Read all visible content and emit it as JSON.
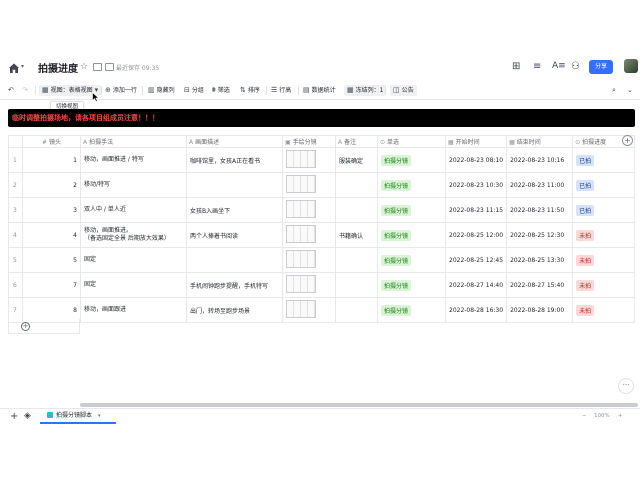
{
  "header": {
    "title": "拍摄进度",
    "save_status": "最近保存 09:35",
    "share_label": "分享"
  },
  "toolbar": {
    "view_label": "视图：表格视图",
    "tooltip": "切换视图",
    "add_row": "添加一行",
    "hide_columns": "隐藏列",
    "group": "分组",
    "filter": "筛选",
    "sort": "排序",
    "row_height": "行高",
    "stats": "数据统计",
    "freeze": "冻结列：1",
    "notice": "公告"
  },
  "banner": {
    "text": "临时调整拍摄场地，请各项目组成员注意！！！",
    "color": "#f54a45"
  },
  "columns": [
    "镜头",
    "拍摄手法",
    "画面描述",
    "手绘分镜",
    "备注",
    "单选",
    "开始时间",
    "结束时间",
    "拍摄进度"
  ],
  "rows": [
    {
      "idx": "1",
      "shot": "1",
      "method": "移动，画面推进 / 特写",
      "desc": "咖啡馆里，女孩A正在看书",
      "note": "服装确定",
      "single": "拍摄分镜",
      "start": "2022-08-23 08:10",
      "end": "2022-08-23 10:16",
      "progress": "已拍"
    },
    {
      "idx": "2",
      "shot": "2",
      "method": "移动/特写",
      "desc": "",
      "note": "",
      "single": "拍摄分镜",
      "start": "2022-08-23 10:30",
      "end": "2022-08-23 11:00",
      "progress": "已拍"
    },
    {
      "idx": "3",
      "shot": "3",
      "method": "双人中 / 单人近",
      "desc": "女孩B入画坐下",
      "note": "",
      "single": "拍摄分镜",
      "start": "2022-08-23 11:15",
      "end": "2022-08-23 11:50",
      "progress": "已拍"
    },
    {
      "idx": "4",
      "shot": "4",
      "method": "移动，画面推进。\n（备选固定全景 后期放大效果）",
      "desc": "两个人捧着书阅读",
      "note": "书籍确认",
      "single": "拍摄分镜",
      "start": "2022-08-25 12:00",
      "end": "2022-08-25 12:30",
      "progress": "未拍"
    },
    {
      "idx": "5",
      "shot": "5",
      "method": "固定",
      "desc": "",
      "note": "",
      "single": "拍摄分镜",
      "start": "2022-08-25 12:45",
      "end": "2022-08-25 13:30",
      "progress": "未拍"
    },
    {
      "idx": "6",
      "shot": "7",
      "method": "固定",
      "desc": "手机闹钟跑步提醒，手机特写",
      "note": "",
      "single": "拍摄分镜",
      "start": "2022-08-27 14:40",
      "end": "2022-08-27 15:40",
      "progress": "未拍"
    },
    {
      "idx": "7",
      "shot": "8",
      "method": "移动，画面跟进",
      "desc": "出门，转场至跑步场景",
      "note": "",
      "single": "拍摄分镜",
      "start": "2022-08-28 16:30",
      "end": "2022-08-28 19:00",
      "progress": "未拍"
    }
  ],
  "sheet_tab": "拍摄分镜脚本",
  "zoom": "100%",
  "colors": {
    "accent": "#3370ff",
    "done_tag": "#d5e2fb",
    "todo_tag": "#fdd8d7",
    "single_tag": "#d9f5d6"
  }
}
